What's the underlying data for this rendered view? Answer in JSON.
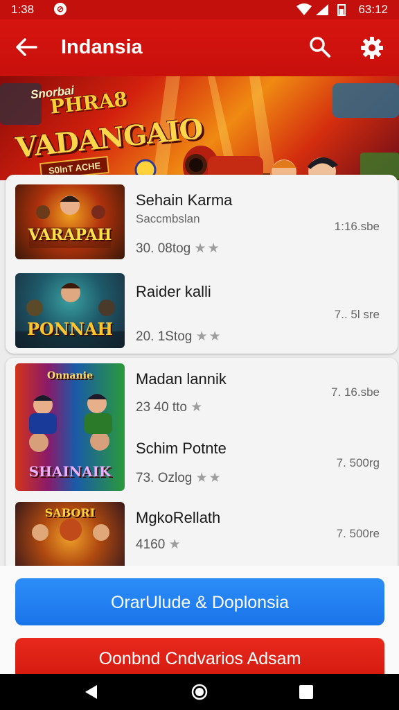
{
  "status_bar": {
    "time": "1:38",
    "notification": "⊘",
    "clock": "63:12"
  },
  "app_bar": {
    "title": "Indansia"
  },
  "banner": {
    "line1": "Snorbai",
    "line2": "PHRA8",
    "line3": "VADANGAIO",
    "tagline": "S0lnT ACHE"
  },
  "group1": [
    {
      "title": "Sehain Karma",
      "subtitle": "Saccmbslan",
      "meta": "30. 08tog",
      "stars": "★★",
      "size": "1:16.sbe",
      "thumb_text": "VARAPAH"
    },
    {
      "title": "Raider kalli",
      "meta": "20. 1Stog",
      "stars": "★★",
      "size": "7.. 5l sre",
      "thumb_text": "PONNAH"
    }
  ],
  "group2": [
    {
      "title": "Madan lannik",
      "meta": "23 40 tto",
      "stars": "★",
      "size": "7. 16.sbe",
      "thumb_text": "SHAINAIK",
      "thumb_top": "Onnanie"
    },
    {
      "title": "Schim Potnte",
      "meta": "73. Ozlog",
      "stars": "★★",
      "size": "7. 500rg"
    },
    {
      "title": "MgkoRellath",
      "meta": "4160",
      "stars": "★",
      "size": "7. 500re",
      "thumb_text": "SABORI"
    }
  ],
  "buttons": {
    "primary": "OrarUlude & Doplonsia",
    "secondary": "Oonbnd Cndvarios Adsam"
  },
  "colors": {
    "accent_red": "#c8100c",
    "primary_blue": "#1a74ea",
    "secondary_red": "#d3190f"
  }
}
